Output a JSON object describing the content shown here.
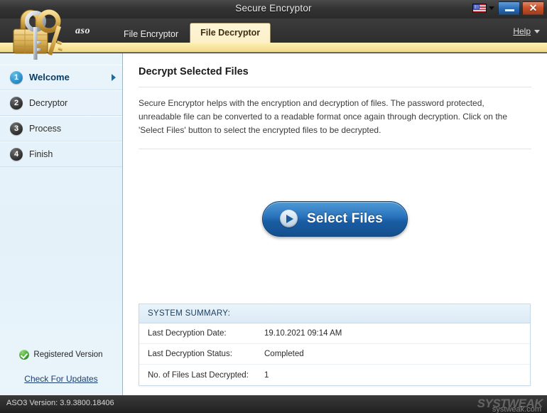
{
  "window": {
    "title": "Secure Encryptor",
    "minimize_label": "_",
    "close_label": "✕",
    "language_flag": "us-flag-icon"
  },
  "tabbar": {
    "brand": "aso",
    "tabs": [
      {
        "label": "File Encryptor",
        "active": false
      },
      {
        "label": "File Decryptor",
        "active": true
      }
    ],
    "help_label": "Help"
  },
  "sidebar": {
    "steps": [
      {
        "number": "1",
        "label": "Welcome",
        "active": true
      },
      {
        "number": "2",
        "label": "Decryptor",
        "active": false
      },
      {
        "number": "3",
        "label": "Process",
        "active": false
      },
      {
        "number": "4",
        "label": "Finish",
        "active": false
      }
    ],
    "registered_label": "Registered Version",
    "updates_label": "Check For Updates"
  },
  "main": {
    "page_title": "Decrypt Selected Files",
    "description": "Secure Encryptor helps with the encryption and decryption of files. The password protected, unreadable file can be converted to a readable format once again through decryption. Click on the 'Select Files' button to select the encrypted files to be decrypted.",
    "select_button_label": "Select Files"
  },
  "summary": {
    "header": "SYSTEM SUMMARY:",
    "rows": [
      {
        "key": "Last Decryption Date:",
        "value": "19.10.2021 09:14 AM"
      },
      {
        "key": "Last Decryption Status:",
        "value": "Completed"
      },
      {
        "key": "No. of Files Last Decrypted:",
        "value": "1"
      }
    ]
  },
  "statusbar": {
    "version_text": "ASO3 Version: 3.9.3800.18406",
    "watermark": "SYSTWEAK",
    "watermark_sub": "systweak.com"
  },
  "colors": {
    "accent_blue": "#1b6ea3",
    "tab_active_bg": "#fbf0c9",
    "strip_yellow": "#f7e49a",
    "summary_header": "#dceaf5",
    "registered_green": "#3da02c",
    "close_red": "#c8532c"
  }
}
